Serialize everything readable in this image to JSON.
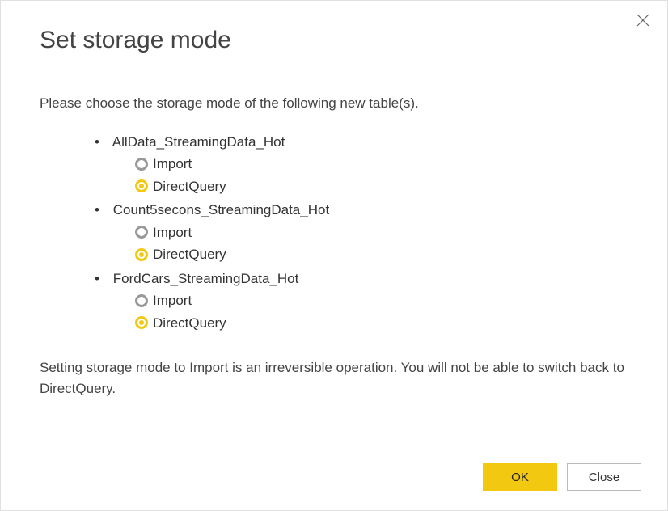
{
  "dialog": {
    "title": "Set storage mode",
    "intro": "Please choose the storage mode of the following new table(s).",
    "warning": "Setting storage mode to Import is an irreversible operation. You will not be able to switch back to DirectQuery.",
    "tables": [
      {
        "name": "AllData_StreamingData_Hot",
        "options": [
          {
            "label": "Import",
            "selected": false
          },
          {
            "label": "DirectQuery",
            "selected": true
          }
        ]
      },
      {
        "name": "Count5secons_StreamingData_Hot",
        "options": [
          {
            "label": "Import",
            "selected": false
          },
          {
            "label": "DirectQuery",
            "selected": true
          }
        ]
      },
      {
        "name": "FordCars_StreamingData_Hot",
        "options": [
          {
            "label": "Import",
            "selected": false
          },
          {
            "label": "DirectQuery",
            "selected": true
          }
        ]
      }
    ],
    "buttons": {
      "ok": "OK",
      "close": "Close"
    }
  }
}
